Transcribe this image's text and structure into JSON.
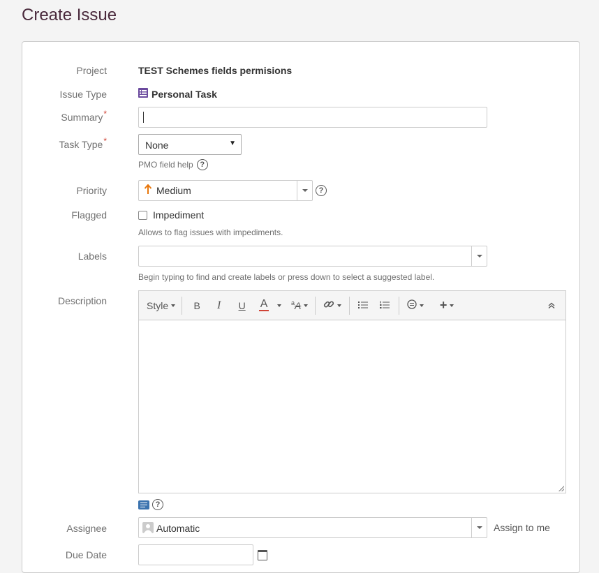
{
  "page": {
    "title": "Create Issue"
  },
  "fields": {
    "project": {
      "label": "Project",
      "value": "TEST Schemes fields permisions"
    },
    "issue_type": {
      "label": "Issue Type",
      "value": "Personal Task"
    },
    "summary": {
      "label": "Summary",
      "required": "*",
      "value": ""
    },
    "task_type": {
      "label": "Task Type",
      "required": "*",
      "value": "None",
      "help": "PMO field help"
    },
    "priority": {
      "label": "Priority",
      "value": "Medium"
    },
    "flagged": {
      "label": "Flagged",
      "option": "Impediment",
      "checked": false,
      "help": "Allows to flag issues with impediments."
    },
    "labels": {
      "label": "Labels",
      "value": "",
      "help": "Begin typing to find and create labels or press down to select a suggested label."
    },
    "description": {
      "label": "Description",
      "toolbar": {
        "style": "Style",
        "bold": "B",
        "italic": "I",
        "underline": "U",
        "color": "A",
        "strikethrough": "A"
      }
    },
    "assignee": {
      "label": "Assignee",
      "value": "Automatic",
      "assign_to_me": "Assign to me"
    },
    "due_date": {
      "label": "Due Date"
    }
  },
  "colors": {
    "title": "#4a2a3c",
    "required": "#d04437",
    "priority_arrow": "#e8760a",
    "text_color": "#d04437",
    "issue_type_icon": "#6b4a9e"
  }
}
